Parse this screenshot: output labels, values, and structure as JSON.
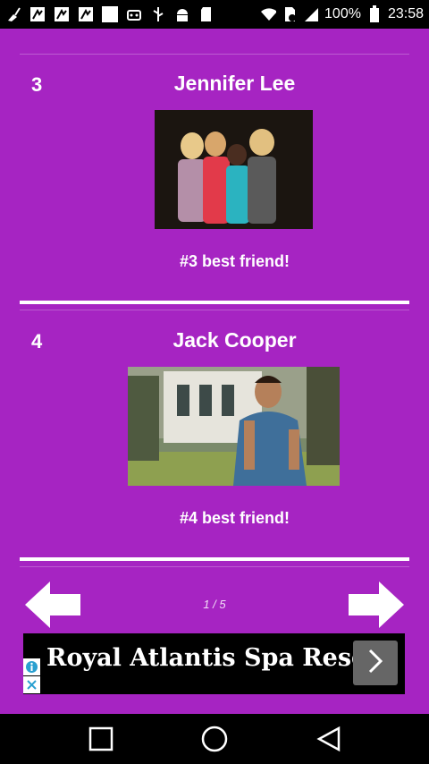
{
  "status_bar": {
    "battery_percent": "100%",
    "time": "23:58",
    "icons": [
      "broom-icon",
      "download-icon",
      "download-icon",
      "download-icon",
      "white-square-icon",
      "voicemail-icon",
      "usb-icon",
      "android-icon",
      "sd-card-icon",
      "wifi-icon",
      "sim-icon",
      "signal-icon",
      "battery-icon"
    ]
  },
  "entries": [
    {
      "rank": "3",
      "name": "Jennifer Lee",
      "caption": "#3 best friend!",
      "image": "group-photo"
    },
    {
      "rank": "4",
      "name": "Jack Cooper",
      "caption": "#4 best friend!",
      "image": "portrait-photo"
    }
  ],
  "pager": {
    "indicator": "1 / 5",
    "prev_icon": "arrow-left-icon",
    "next_icon": "arrow-right-icon"
  },
  "ad": {
    "text": "Royal Atlantis Spa Resort",
    "cta_icon": "chevron-right-icon"
  },
  "nav": {
    "recents_icon": "square-icon",
    "home_icon": "circle-icon",
    "back_icon": "triangle-back-icon"
  },
  "colors": {
    "background": "#a624c2",
    "accent": "#ffffff"
  }
}
